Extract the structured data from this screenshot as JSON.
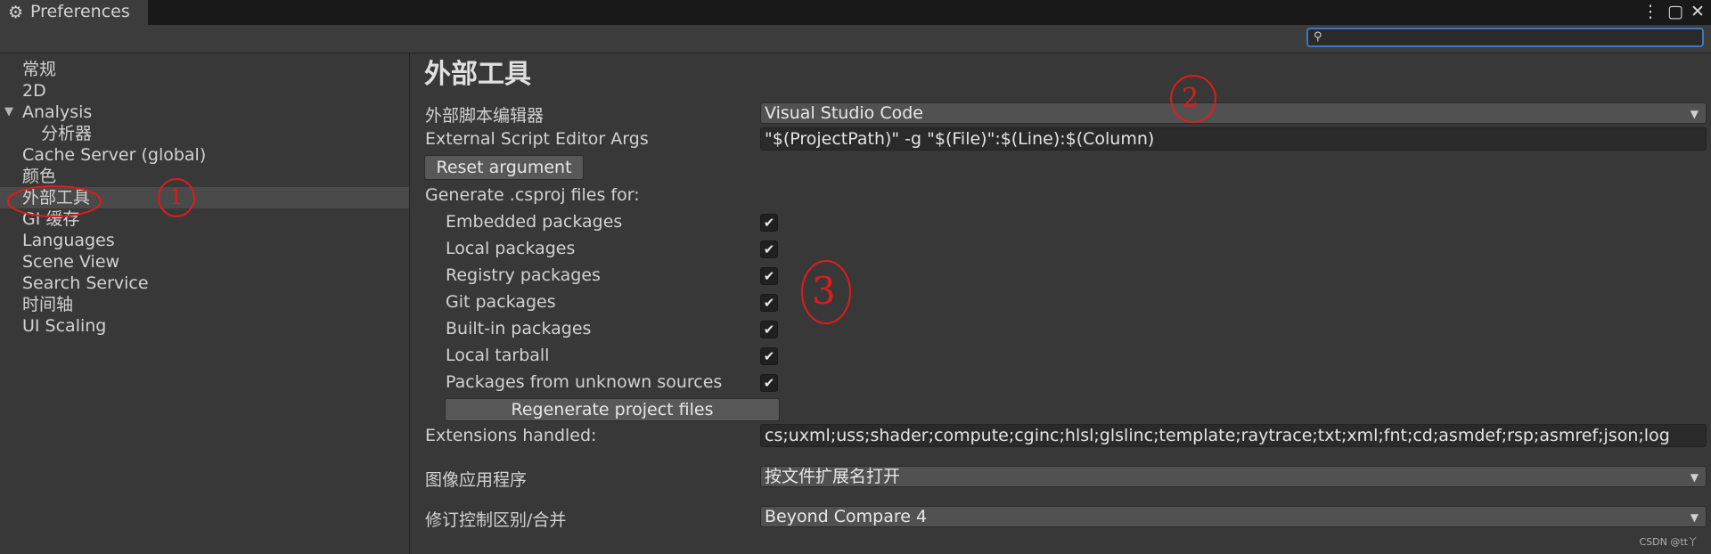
{
  "window": {
    "tab_title": "Preferences",
    "tab_icon": "gear-icon",
    "menu_icon": "⋮",
    "maximize_icon": "▢",
    "close_icon": "✕"
  },
  "search": {
    "placeholder": "",
    "icon": "⚲"
  },
  "sidebar": {
    "items": [
      {
        "label": "常规"
      },
      {
        "label": "2D"
      },
      {
        "label": "Analysis",
        "expanded": true
      },
      {
        "label": "分析器"
      },
      {
        "label": "Cache Server (global)"
      },
      {
        "label": "颜色"
      },
      {
        "label": "外部工具",
        "selected": true
      },
      {
        "label": "GI 缓存"
      },
      {
        "label": "Languages"
      },
      {
        "label": "Scene View"
      },
      {
        "label": "Search Service"
      },
      {
        "label": "时间轴"
      },
      {
        "label": "UI Scaling"
      }
    ]
  },
  "main": {
    "title": "外部工具",
    "editor_label": "外部脚本编辑器",
    "editor_value": "Visual Studio Code",
    "args_label": "External Script Editor Args",
    "args_value": "\"$(ProjectPath)\" -g \"$(File)\":$(Line):$(Column)",
    "reset_button": "Reset argument",
    "generate_label": "Generate .csproj files for:",
    "packages": [
      {
        "label": "Embedded packages",
        "checked": true
      },
      {
        "label": "Local packages",
        "checked": true
      },
      {
        "label": "Registry packages",
        "checked": true
      },
      {
        "label": "Git packages",
        "checked": true
      },
      {
        "label": "Built-in packages",
        "checked": true
      },
      {
        "label": "Local tarball",
        "checked": true
      },
      {
        "label": "Packages from unknown sources",
        "checked": true
      }
    ],
    "check_glyph": "✔",
    "regenerate_button": "Regenerate project files",
    "extensions_label": "Extensions handled:",
    "extensions_value": "cs;uxml;uss;shader;compute;cginc;hlsl;glslinc;template;raytrace;txt;xml;fnt;cd;asmdef;rsp;asmref;json;log",
    "image_label": "图像应用程序",
    "image_value": "按文件扩展名打开",
    "revision_label": "修订控制区别/合并",
    "revision_value": "Beyond Compare 4",
    "dropdown_arrow": "▼"
  },
  "annotations": {
    "marker1": "1",
    "marker2": "2",
    "marker3": "3"
  },
  "watermark": "CSDN @tt丫",
  "colors": {
    "background": "#383838",
    "titlebar": "#191919",
    "selected": "#4a4a4a",
    "accent": "#3a79bb",
    "annotation": "#e01b1b"
  }
}
